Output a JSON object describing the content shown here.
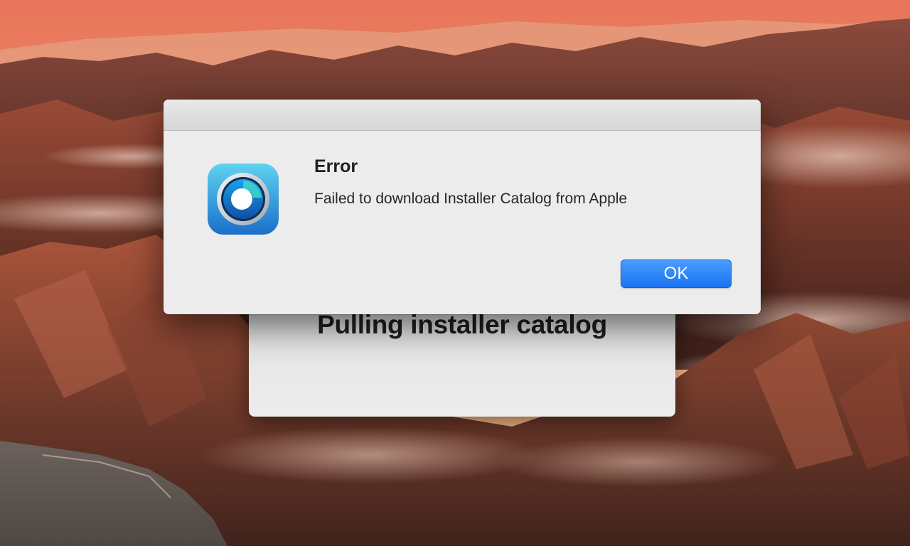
{
  "background_window": {
    "title": "Pulling installer catalog"
  },
  "alert": {
    "icon": "app-icon",
    "title": "Error",
    "message": "Failed to download Installer Catalog from Apple",
    "ok_label": "OK",
    "accent_color": "#1a73f2"
  }
}
